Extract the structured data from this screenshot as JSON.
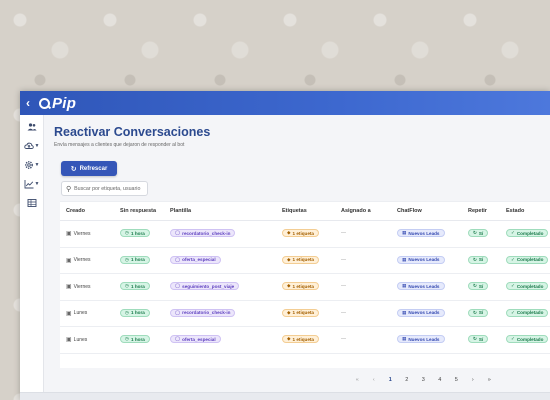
{
  "app": {
    "name": "Pip",
    "back_icon": "chevron-left-icon"
  },
  "sidebar": {
    "items": [
      {
        "icon": "users-icon",
        "has_caret": false
      },
      {
        "icon": "cloud-upload-icon",
        "has_caret": true
      },
      {
        "icon": "gear-icon",
        "has_caret": true
      },
      {
        "icon": "chart-line-icon",
        "has_caret": true
      },
      {
        "icon": "table-icon",
        "has_caret": false
      }
    ]
  },
  "page": {
    "title": "Reactivar Conversaciones",
    "subtitle": "Envía mensajes a clientes que dejaron de responder al bot"
  },
  "toolbar": {
    "refresh_label": "Refrescar",
    "refresh_icon": "refresh-icon",
    "search_placeholder": "Buscar por etiqueta, usuario",
    "search_value": ""
  },
  "table": {
    "columns": [
      "Creado",
      "Sin respuesta",
      "Plantilla",
      "Etiquetas",
      "Asignado a",
      "ChatFlow",
      "Repetir",
      "Estado"
    ],
    "rows": [
      {
        "created": "Viernes",
        "no_response": "1 hora",
        "template": "recordatorio_check-in",
        "tags": "1 etiqueta",
        "assigned": "—",
        "chatflow": "Nuevos Leads",
        "repeat": "Sí",
        "status": "Completado"
      },
      {
        "created": "Viernes",
        "no_response": "1 hora",
        "template": "oferta_especial",
        "tags": "1 etiqueta",
        "assigned": "—",
        "chatflow": "Nuevos Leads",
        "repeat": "Sí",
        "status": "Completado"
      },
      {
        "created": "Viernes",
        "no_response": "1 hora",
        "template": "seguimiento_post_viaje",
        "tags": "1 etiqueta",
        "assigned": "—",
        "chatflow": "Nuevos Leads",
        "repeat": "Sí",
        "status": "Completado"
      },
      {
        "created": "Lunes",
        "no_response": "1 hora",
        "template": "recordatorio_check-in",
        "tags": "1 etiqueta",
        "assigned": "—",
        "chatflow": "Nuevos Leads",
        "repeat": "Sí",
        "status": "Completado"
      },
      {
        "created": "Lunes",
        "no_response": "1 hora",
        "template": "oferta_especial",
        "tags": "1 etiqueta",
        "assigned": "—",
        "chatflow": "Nuevos Leads",
        "repeat": "Sí",
        "status": "Completado"
      }
    ]
  },
  "pagination": {
    "first": "«",
    "prev": "‹",
    "pages": [
      "1",
      "2",
      "3",
      "4",
      "5"
    ],
    "current": "1",
    "next": "›",
    "last": "»"
  },
  "colors": {
    "brand": "#3556b8",
    "title": "#2c4a8f",
    "success": "#1a7a4b",
    "template": "#5d3fbf",
    "tag": "#a35f00",
    "flow": "#3348b0"
  }
}
